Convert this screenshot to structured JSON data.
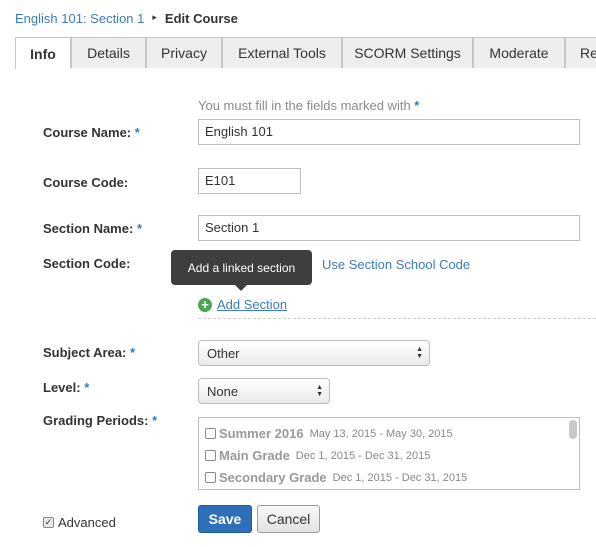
{
  "breadcrumb": {
    "course": "English 101: Section 1",
    "separator": "▸",
    "current": "Edit Course"
  },
  "tabs": [
    {
      "label": "Info"
    },
    {
      "label": "Details"
    },
    {
      "label": "Privacy"
    },
    {
      "label": "External Tools"
    },
    {
      "label": "SCORM Settings"
    },
    {
      "label": "Moderate"
    },
    {
      "label": "Re"
    }
  ],
  "form": {
    "required_note": "You must fill in the fields marked with",
    "required_mark": "*",
    "course_name": {
      "label": "Course Name:",
      "value": "English 101"
    },
    "course_code": {
      "label": "Course Code:",
      "value": "E101"
    },
    "section_name": {
      "label": "Section Name:",
      "value": "Section 1"
    },
    "section_code": {
      "label": "Section Code:",
      "link": "Use Section School Code"
    },
    "tooltip": "Add a linked section",
    "add_section": "Add Section",
    "subject_area": {
      "label": "Subject Area:",
      "value": "Other"
    },
    "level": {
      "label": "Level:",
      "value": "None"
    },
    "grading_periods": {
      "label": "Grading Periods:",
      "items": [
        {
          "name": "Summer 2016",
          "dates": "May 13, 2015 - May 30, 2015",
          "checked": false
        },
        {
          "name": "Main Grade",
          "dates": "Dec 1, 2015 - Dec 31, 2015",
          "checked": false
        },
        {
          "name": "Secondary Grade",
          "dates": "Dec 1, 2015 - Dec 31, 2015",
          "checked": false
        }
      ]
    },
    "advanced": {
      "label": "Advanced",
      "checked": true
    }
  },
  "buttons": {
    "save": "Save",
    "cancel": "Cancel"
  },
  "colors": {
    "link": "#3b7bbf",
    "save_button": "#2f6fb8",
    "add_icon": "#4fa650",
    "tooltip": "#3e3e3e"
  }
}
